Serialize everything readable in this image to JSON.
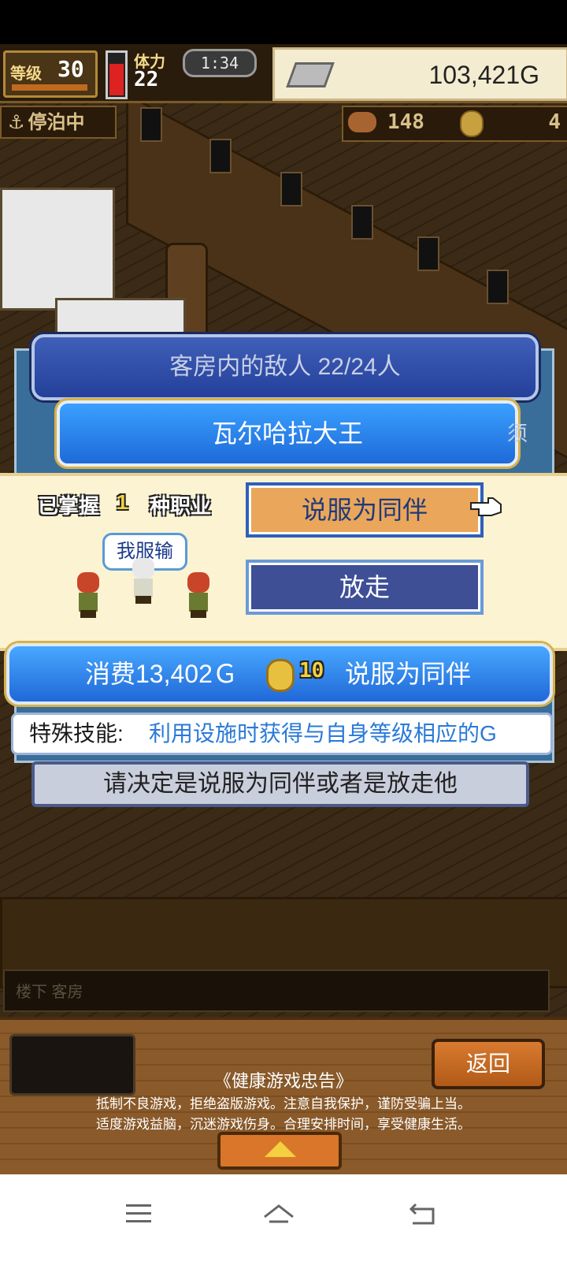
{
  "hud": {
    "level_label": "等级",
    "level": "30",
    "stamina_label": "体力",
    "stamina": "22",
    "time": "1:34",
    "money": "103,421G"
  },
  "subhud": {
    "dock_status": "停泊中",
    "food": "148",
    "medals": "4"
  },
  "dialog": {
    "enemy_header": "客房内的敌人  22/24人",
    "boss_name": "瓦尔哈拉大王",
    "boss_side_char": "须",
    "jobs_prefix": "已掌握",
    "jobs_count": "1",
    "jobs_suffix": "种职业",
    "speech_bubble": "我服输",
    "persuade_label": "说服为同伴",
    "release_label": "放走",
    "cost_prefix": "消费13,402Ｇ",
    "cost_coins": "10",
    "cost_suffix": "说服为同伴",
    "skill_label": "特殊技能:",
    "skill_desc": "利用设施时获得与自身等级相应的G",
    "prompt": "请决定是说服为同伴或者是放走他"
  },
  "location": "楼下 客房",
  "bottom": {
    "back_label": "返回",
    "health_title": "《健康游戏忠告》",
    "health_line1": "抵制不良游戏，拒绝盗版游戏。注意自我保护，谨防受骗上当。",
    "health_line2": "适度游戏益脑，沉迷游戏伤身。合理安排时间，享受健康生活。"
  },
  "colors": {
    "accent_blue": "#2068d8",
    "persuade_orange": "#eaa65a",
    "panel_cream": "#fbf3d2",
    "wood": "#8a5a2a"
  },
  "icons": [
    "anchor-icon",
    "food-icon",
    "medal-icon",
    "money-icon",
    "coin-icon",
    "pointer-hand-icon",
    "expand-up-icon",
    "menu-icon",
    "home-icon",
    "back-icon"
  ]
}
